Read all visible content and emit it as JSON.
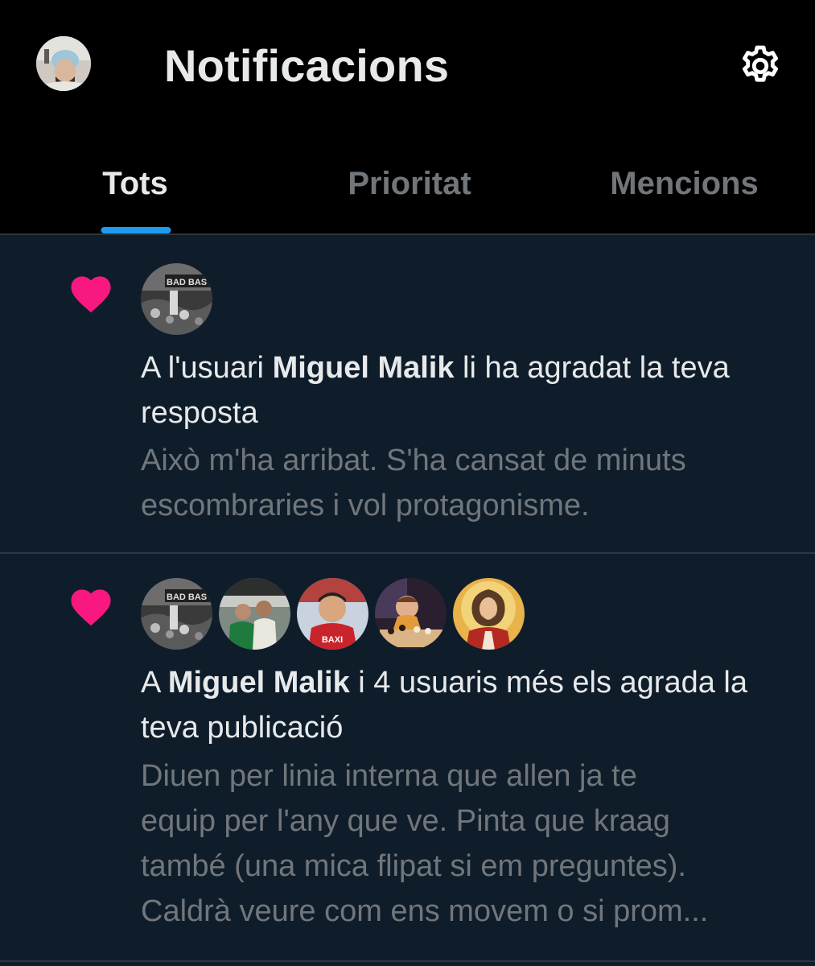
{
  "header": {
    "title": "Notificacions",
    "avatar_icon": "user-avatar",
    "settings_icon": "gear-icon"
  },
  "tabs": [
    {
      "label": "Tots",
      "active": true
    },
    {
      "label": "Prioritat",
      "active": false
    },
    {
      "label": "Mencions",
      "active": false
    }
  ],
  "colors": {
    "background": "#0f1d2b",
    "header_bg": "#000000",
    "accent": "#1d9bf0",
    "heart": "#f91880",
    "text_primary": "#e7e9ea",
    "text_secondary": "#71767b"
  },
  "notifications": [
    {
      "type": "like",
      "icon": "heart-icon",
      "headline_pre": "A l'usuari ",
      "headline_user": "Miguel Malik",
      "headline_post": " li ha agradat la teva resposta",
      "preview_lines": [
        "Això m'ha arribat. S'ha cansat de minuts",
        "escombraries i vol protagonisme."
      ]
    },
    {
      "type": "like",
      "icon": "heart-icon",
      "headline_pre": "A ",
      "headline_user": "Miguel Malik",
      "headline_post": " i 4 usuaris més els agrada la teva publicació",
      "preview_lines": [
        "Diuen per linia interna que allen ja te",
        "equip per l'any que ve. Pinta que kraag",
        "també (una mica flipat si em preguntes).",
        "Caldrà veure com ens movem o si prom..."
      ],
      "avatar_badges": {
        "first": "BAD BAS",
        "third": "BAXI"
      }
    }
  ]
}
